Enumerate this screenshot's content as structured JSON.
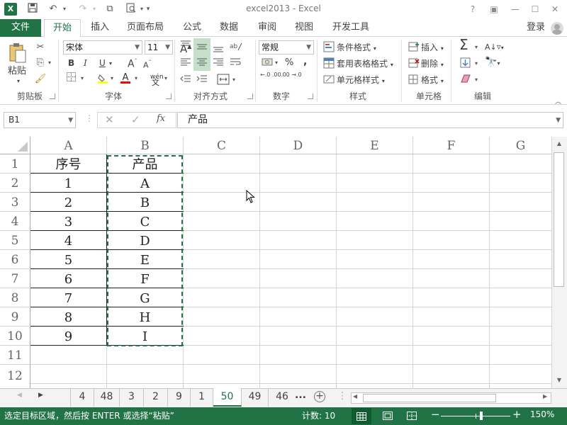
{
  "app": {
    "window_title": "excel2013 - Excel",
    "user": "登录",
    "logo": "X"
  },
  "tabs": [
    "文件",
    "开始",
    "插入",
    "页面布局",
    "公式",
    "数据",
    "审阅",
    "视图",
    "开发工具"
  ],
  "ribbon": {
    "clipboard": {
      "label": "剪贴板",
      "paste": "粘贴"
    },
    "font": {
      "label": "字体",
      "family": "宋体",
      "size": "11",
      "bold": "B",
      "italic": "I",
      "underline": "U",
      "grow": "A",
      "shrink": "A",
      "wen": "wén"
    },
    "alignment": {
      "label": "对齐方式"
    },
    "number": {
      "label": "数字",
      "format": "常规",
      "percent": "%",
      "comma": ",",
      "inc": "←.0 .00",
      "dec": ".00 →.0"
    },
    "styles": {
      "label": "样式",
      "cond": "条件格式",
      "table": "套用表格格式",
      "cell": "单元格样式"
    },
    "cells": {
      "label": "单元格",
      "insert": "插入",
      "delete": "删除",
      "format": "格式"
    },
    "editing": {
      "label": "编辑"
    }
  },
  "formula_bar": {
    "name_box": "B1",
    "fx": "fx",
    "content": "产品"
  },
  "columns": [
    "A",
    "B",
    "C",
    "D",
    "E",
    "F",
    "G"
  ],
  "rows": [
    "1",
    "2",
    "3",
    "4",
    "5",
    "6",
    "7",
    "8",
    "9",
    "10",
    "11",
    "12"
  ],
  "table": {
    "headers": [
      "序号",
      "产品"
    ],
    "rows": [
      [
        "1",
        "A"
      ],
      [
        "2",
        "B"
      ],
      [
        "3",
        "C"
      ],
      [
        "4",
        "D"
      ],
      [
        "5",
        "E"
      ],
      [
        "6",
        "F"
      ],
      [
        "7",
        "G"
      ],
      [
        "8",
        "H"
      ],
      [
        "9",
        "I"
      ]
    ]
  },
  "sheet_tabs": {
    "items": [
      "4",
      "48",
      "3",
      "2",
      "9",
      "1",
      "50",
      "49",
      "46"
    ],
    "active": "50",
    "more": "..."
  },
  "status": {
    "message": "选定目标区域，然后按 ENTER 或选择“粘贴”",
    "count": "计数: 10",
    "zoom": "150%"
  }
}
